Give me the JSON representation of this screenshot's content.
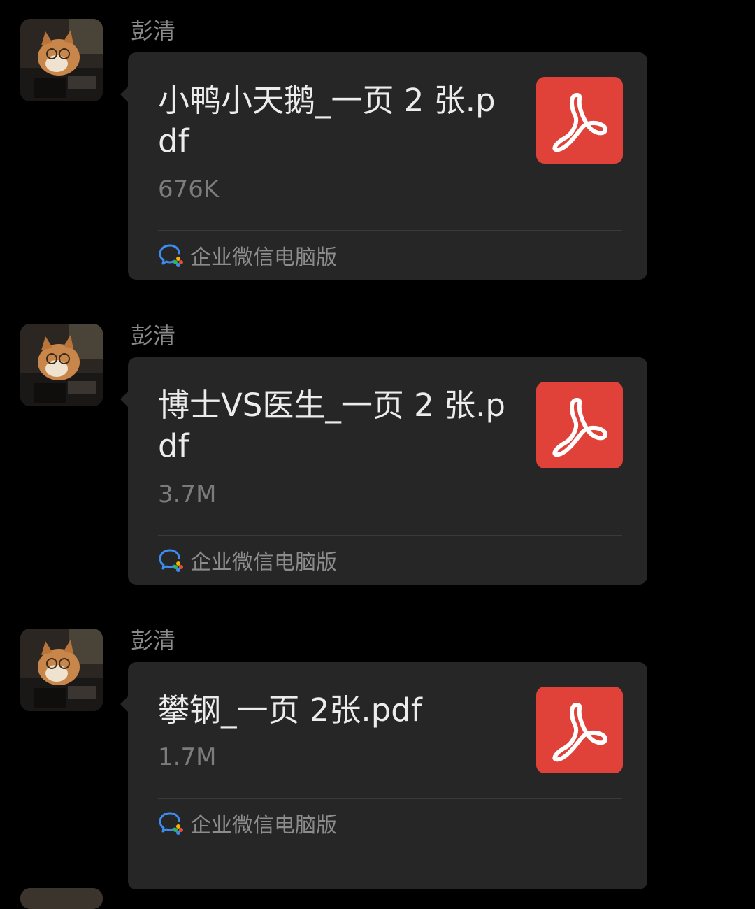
{
  "accent": {
    "pdf_red": "#e0423a",
    "bubble_bg": "#262626",
    "page_bg": "#000000"
  },
  "messages": [
    {
      "sender": "彭清",
      "file_name": "小鸭小天鹅_一页 2 张.pdf",
      "file_size": "676K",
      "source_label": "企业微信电脑版",
      "file_icon": "pdf-icon"
    },
    {
      "sender": "彭清",
      "file_name": "博士VS医生_一页 2 张.pdf",
      "file_size": "3.7M",
      "source_label": "企业微信电脑版",
      "file_icon": "pdf-icon"
    },
    {
      "sender": "彭清",
      "file_name": "攀钢_一页 2张.pdf",
      "file_size": "1.7M",
      "source_label": "企业微信电脑版",
      "file_icon": "pdf-icon"
    }
  ]
}
